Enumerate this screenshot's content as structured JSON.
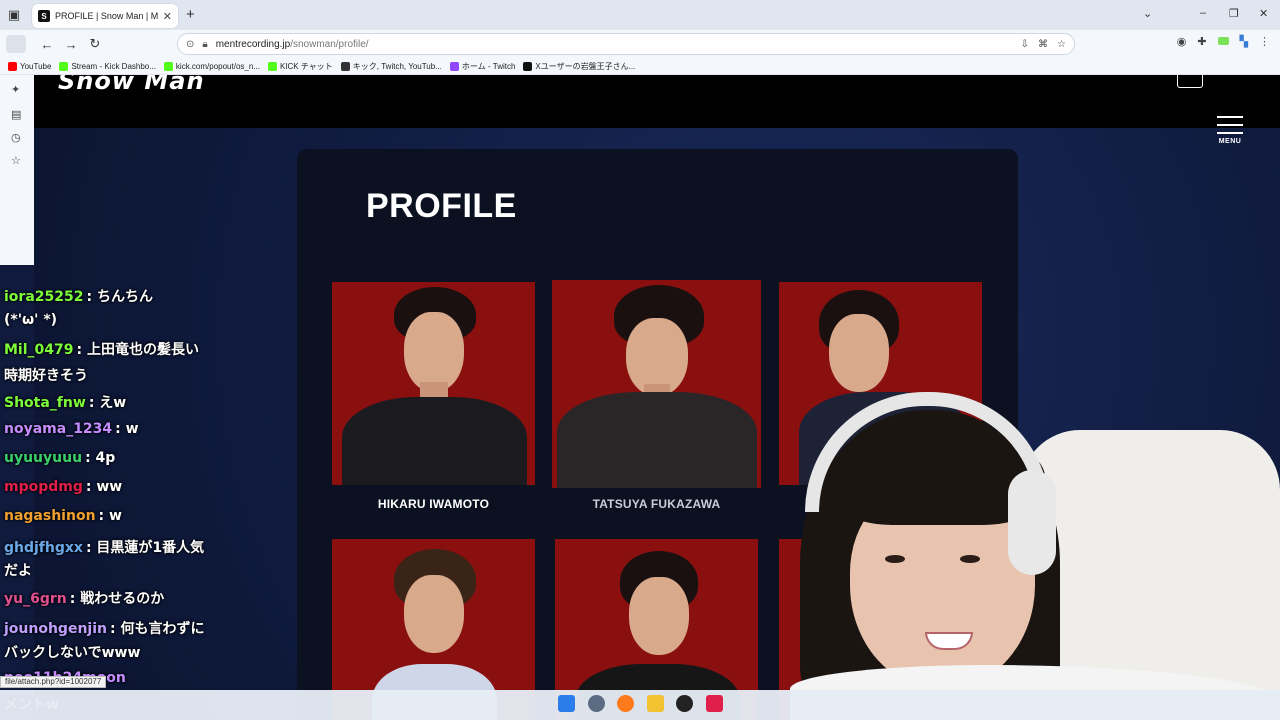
{
  "browser": {
    "tab": {
      "favicon_letter": "S",
      "title": "PROFILE | Snow Man | MENT R",
      "close": "✕"
    },
    "new_tab": "+",
    "url": {
      "host": "mentrecording.jp",
      "path": "/snowman/profile/"
    },
    "bookmarks": [
      {
        "label": "YouTube",
        "color": "#ff0000"
      },
      {
        "label": "Stream - Kick Dashbo...",
        "color": "#53fc18"
      },
      {
        "label": "kick.com/popout/os_n...",
        "color": "#53fc18"
      },
      {
        "label": "KICK チャット",
        "color": "#53fc18"
      },
      {
        "label": "キック, Twitch, YouTub...",
        "color": "#333333"
      },
      {
        "label": "ホーム - Twitch",
        "color": "#9146ff"
      },
      {
        "label": "Xユーザーの岩盤王子さん...",
        "color": "#111111"
      }
    ]
  },
  "site": {
    "logo": "Snow Man",
    "menu_label": "MENU",
    "page_title": "PROFILE",
    "members": [
      {
        "name": "HIKARU IWAMOTO"
      },
      {
        "name": "TATSUYA FUKAZAWA"
      },
      {
        "name": ""
      },
      {
        "name": ""
      },
      {
        "name": ""
      },
      {
        "name": ""
      }
    ]
  },
  "chat": {
    "messages": [
      {
        "user": "iora25252",
        "text": ": ちんちん",
        "user_color": "#7cfc3a"
      },
      {
        "user": "",
        "text": "(*'ω' *)",
        "user_color": "#ffffff"
      },
      {
        "user": "Mil_0479",
        "text": ": 上田竜也の髪長い",
        "user_color": "#7cfc3a"
      },
      {
        "user": "",
        "text": "時期好きそう",
        "user_color": "#ffffff"
      },
      {
        "user": "Shota_fnw",
        "text": ": えw",
        "user_color": "#7cfc3a"
      },
      {
        "user": "noyama_1234",
        "text": ": w",
        "user_color": "#c58cff"
      },
      {
        "user": "uyuuyuuu",
        "text": ": 4p",
        "user_color": "#3ad06b"
      },
      {
        "user": "mpopdmg",
        "text": ": ww",
        "user_color": "#e0204a"
      },
      {
        "user": "nagashinon",
        "text": ": w",
        "user_color": "#f0a030"
      },
      {
        "user": "ghdjfhgxx",
        "text": ": 目黒蓮が1番人気",
        "user_color": "#6aa8e8"
      },
      {
        "user": "",
        "text": "だよ",
        "user_color": "#ffffff"
      },
      {
        "user": "yu_6grn",
        "text": ": 戦わせるのか",
        "user_color": "#e05090"
      },
      {
        "user": "jounohgenjin",
        "text": ": 何も言わずに",
        "user_color": "#c0a0ff"
      },
      {
        "user": "",
        "text": "バックしないでwww",
        "user_color": "#ffffff"
      },
      {
        "user": "neo11b24moon",
        "text": "",
        "user_color": "#c58cff"
      },
      {
        "user": "",
        "text": "メントw",
        "user_color": "#ffffff"
      }
    ],
    "status_link": "file/attach.php?id=1002077"
  }
}
